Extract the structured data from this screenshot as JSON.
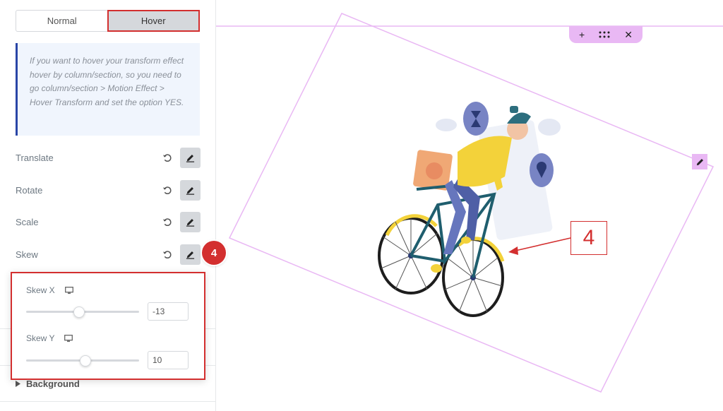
{
  "tabs": {
    "normal": "Normal",
    "hover": "Hover"
  },
  "info_text": "If you want to hover your transform effect hover by column/section, so you need to go column/section > Motion Effect > Hover Transform and set the option YES.",
  "controls": [
    {
      "label": "Translate"
    },
    {
      "label": "Rotate"
    },
    {
      "label": "Scale"
    },
    {
      "label": "Skew"
    }
  ],
  "skew_popover": {
    "skew_x": {
      "label": "Skew X",
      "value": "-13",
      "level": 0.46
    },
    "skew_y": {
      "label": "Skew Y",
      "value": "10",
      "level": 0.54
    }
  },
  "background_section": "Background",
  "step_badge": "4",
  "callout_label": "4",
  "colors": {
    "accent_red": "#d32f2f",
    "info_border": "#2945a6",
    "selection_pink": "#e9b8f4"
  },
  "icons": [
    "reset-icon",
    "pencil-icon",
    "desktop-icon",
    "plus-icon",
    "grid-handle-icon",
    "close-icon",
    "caret-right-icon"
  ]
}
